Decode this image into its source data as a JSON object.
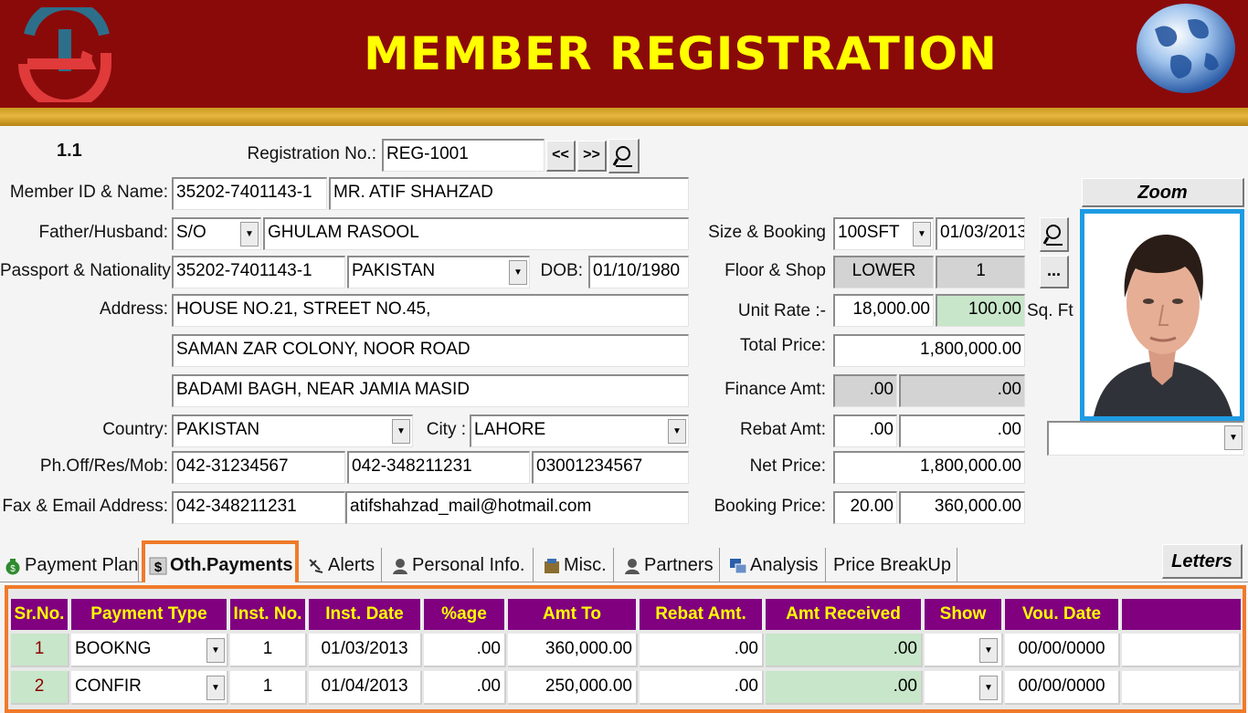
{
  "header": {
    "title": "MEMBER REGISTRATION",
    "colors": {
      "banner": "#8a0a0a",
      "title": "#ffff00",
      "gold": "#e6b640"
    },
    "logo_icon": "company-logo-icon",
    "globe_icon": "globe-icon"
  },
  "form": {
    "record_index": "1.1",
    "registration_label": "Registration No.:",
    "registration_no": "REG-1001",
    "prev_label": "<<",
    "next_label": ">>",
    "member_label": "Member ID & Name:",
    "member_id": "35202-7401143-1",
    "member_name": "MR. ATIF SHAHZAD",
    "father_label": "Father/Husband:",
    "relation": "S/O",
    "father_name": "GHULAM RASOOL",
    "passport_label": "Passport & Nationality:",
    "passport": "35202-7401143-1",
    "nationality": "PAKISTAN",
    "dob_label": "DOB:",
    "dob": "01/10/1980",
    "address_label": "Address:",
    "address_line1": "HOUSE NO.21, STREET NO.45,",
    "address_line2": "SAMAN ZAR COLONY, NOOR ROAD",
    "address_line3": "BADAMI BAGH, NEAR JAMIA MASID",
    "country_label": "Country:",
    "country": "PAKISTAN",
    "city_label": "City :",
    "city": "LAHORE",
    "phone_label": "Ph.Off/Res/Mob:",
    "phone_off": "042-31234567",
    "phone_res": "042-348211231",
    "phone_mob": "03001234567",
    "fax_label": "Fax & Email Address:",
    "fax": "042-348211231",
    "email": "atifshahzad_mail@hotmail.com",
    "size_label": "Size & Booking",
    "size": "100SFT",
    "booking_date": "01/03/2013",
    "floor_label": "Floor & Shop",
    "floor": "LOWER",
    "shop": "1",
    "more_label": "...",
    "unit_rate_label": "Unit Rate :-",
    "unit_rate": "18,000.00",
    "area": "100.00",
    "area_unit": "Sq. Ft",
    "total_label": "Total Price:",
    "total_price": "1,800,000.00",
    "finance_label": "Finance Amt:",
    "finance_pct": ".00",
    "finance_amt": ".00",
    "rebat_label": "Rebat Amt:",
    "rebat_pct": ".00",
    "rebat_amt": ".00",
    "net_label": "Net Price:",
    "net_price": "1,800,000.00",
    "booking_price_label": "Booking Price:",
    "booking_pct": "20.00",
    "booking_amt": "360,000.00",
    "zoom_label": "Zoom",
    "photo_selector": ""
  },
  "tabs": [
    {
      "label": "Payment Plan",
      "icon": "money-bag-icon"
    },
    {
      "label": "Oth.Payments",
      "icon": "dollar-icon",
      "active": true
    },
    {
      "label": "Alerts",
      "icon": "alert-icon"
    },
    {
      "label": "Personal Info.",
      "icon": "person-icon"
    },
    {
      "label": "Misc.",
      "icon": "misc-icon"
    },
    {
      "label": "Partners",
      "icon": "partners-icon"
    },
    {
      "label": "Analysis",
      "icon": "analysis-icon"
    },
    {
      "label": "Price BreakUp",
      "icon": ""
    }
  ],
  "letters_label": "Letters",
  "grid": {
    "headers": [
      "Sr.No.",
      "Payment Type",
      "Inst. No.",
      "Inst. Date",
      "%age",
      "Amt To Receive",
      "Rebat Amt.",
      "Amt Received",
      "Show",
      "Vou. Date"
    ],
    "rows": [
      {
        "sr": "1",
        "type": "BOOKNG",
        "inst_no": "1",
        "inst_date": "01/03/2013",
        "pct": ".00",
        "amt_to_receive": "360,000.00",
        "rebat": ".00",
        "received": ".00",
        "show": "",
        "vou_date": "00/00/0000"
      },
      {
        "sr": "2",
        "type": "CONFIR",
        "inst_no": "1",
        "inst_date": "01/04/2013",
        "pct": ".00",
        "amt_to_receive": "250,000.00",
        "rebat": ".00",
        "received": ".00",
        "show": "",
        "vou_date": "00/00/0000"
      }
    ],
    "header_color": "#800080",
    "header_text_color": "#ffff00",
    "highlight_color": "#f07a2a"
  }
}
